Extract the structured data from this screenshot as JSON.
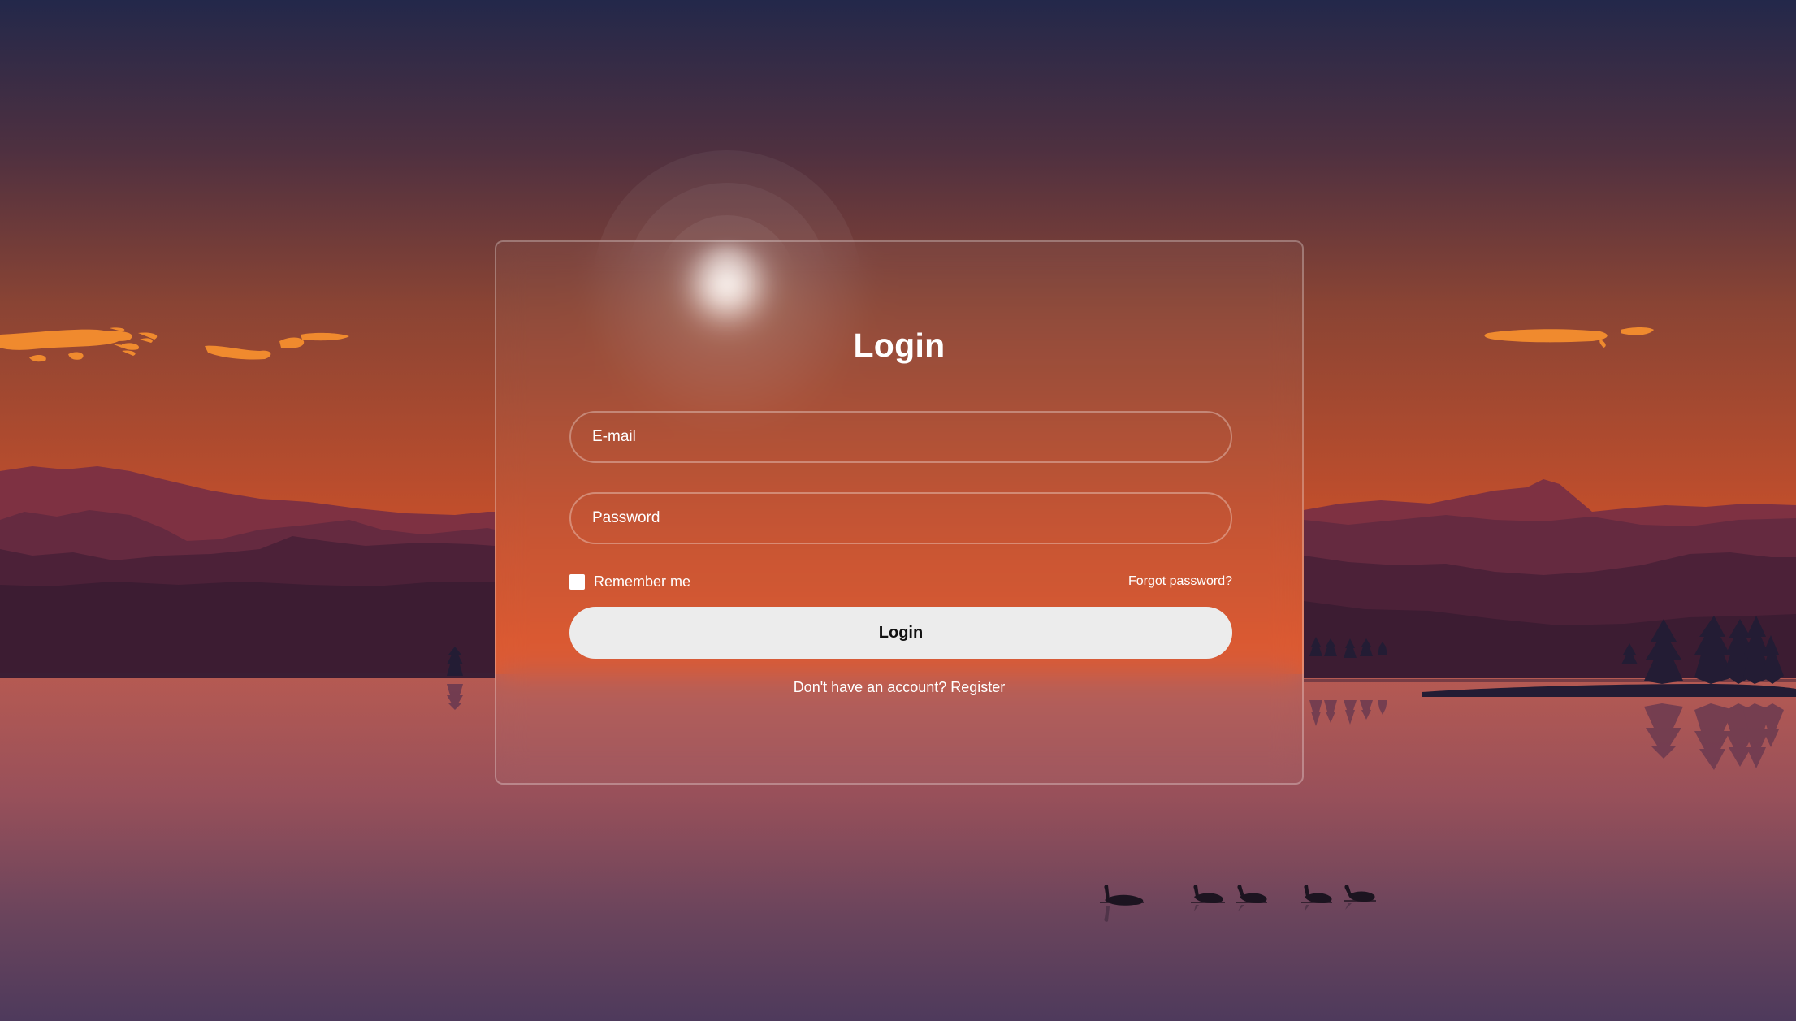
{
  "page": {
    "title": "Login"
  },
  "form": {
    "email_placeholder": "E-mail",
    "email_value": "",
    "password_placeholder": "Password",
    "password_value": "",
    "remember_label": "Remember me",
    "remember_checked": false,
    "forgot_label": "Forgot password?",
    "submit_label": "Login",
    "register_prompt": "Don't have an account?",
    "register_link": "Register"
  },
  "background": {
    "sky_top": "#23284a",
    "sky_horizon": "#e0552a",
    "water_top": "#b65a52",
    "water_bottom": "#4e3a5c",
    "mountain_far": "#7b3040",
    "mountain_near": "#4a2036",
    "trees": "#231c34",
    "clouds": "#f08a2e",
    "sun": "#ffffff"
  }
}
